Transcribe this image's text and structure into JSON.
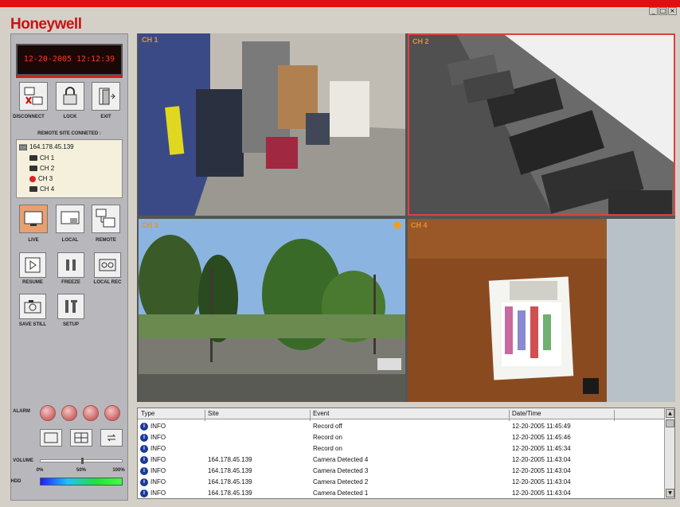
{
  "app": {
    "logo": "Honeywell"
  },
  "window_controls": {
    "minimize": "_",
    "maximize": "□",
    "close": "×"
  },
  "clock": "12-20-2005 12:12:39",
  "top_buttons": {
    "disconnect": "DISCONNECT",
    "lock": "LOCK",
    "exit": "EXIT"
  },
  "remote_site": {
    "title": "REMOTE SITE CONNETED :",
    "ip": "164.178.45.139",
    "channels": [
      "CH 1",
      "CH 2",
      "CH 3",
      "CH 4"
    ],
    "recording_channel": "CH 3"
  },
  "view_buttons": {
    "live": "LIVE",
    "local": "LOCAL",
    "remote": "REMOTE"
  },
  "playback_buttons": {
    "resume": "RESUME",
    "freeze": "FREEZE",
    "local_rec": "LOCAL REC"
  },
  "tool_buttons": {
    "save_still": "SAVE STILL",
    "setup": "SETUP"
  },
  "alarm": {
    "label": "ALARM"
  },
  "volume": {
    "label": "VOLUME",
    "ticks": [
      "0%",
      "50%",
      "100%"
    ],
    "level": 0.5
  },
  "hdd": {
    "label": "HDD"
  },
  "video": {
    "ch1": "CH 1",
    "ch2": "CH 2",
    "ch3": "CH 3",
    "ch4": "CH 4",
    "selected": "CH 2"
  },
  "log": {
    "columns": [
      "Type",
      "Site",
      "Event",
      "Date/Time"
    ],
    "rows": [
      {
        "type": "INFO",
        "site": "",
        "event": "Record off",
        "datetime": "12-20-2005 11:45:49"
      },
      {
        "type": "INFO",
        "site": "",
        "event": "Record on",
        "datetime": "12-20-2005 11:45:46"
      },
      {
        "type": "INFO",
        "site": "",
        "event": "Record on",
        "datetime": "12-20-2005 11:45:34"
      },
      {
        "type": "INFO",
        "site": "164.178.45.139",
        "event": "Camera Detected 4",
        "datetime": "12-20-2005 11:43:04"
      },
      {
        "type": "INFO",
        "site": "164.178.45.139",
        "event": "Camera Detected 3",
        "datetime": "12-20-2005 11:43:04"
      },
      {
        "type": "INFO",
        "site": "164.178.45.139",
        "event": "Camera Detected 2",
        "datetime": "12-20-2005 11:43:04"
      },
      {
        "type": "INFO",
        "site": "164.178.45.139",
        "event": "Camera Detected 1",
        "datetime": "12-20-2005 11:43:04"
      }
    ]
  }
}
